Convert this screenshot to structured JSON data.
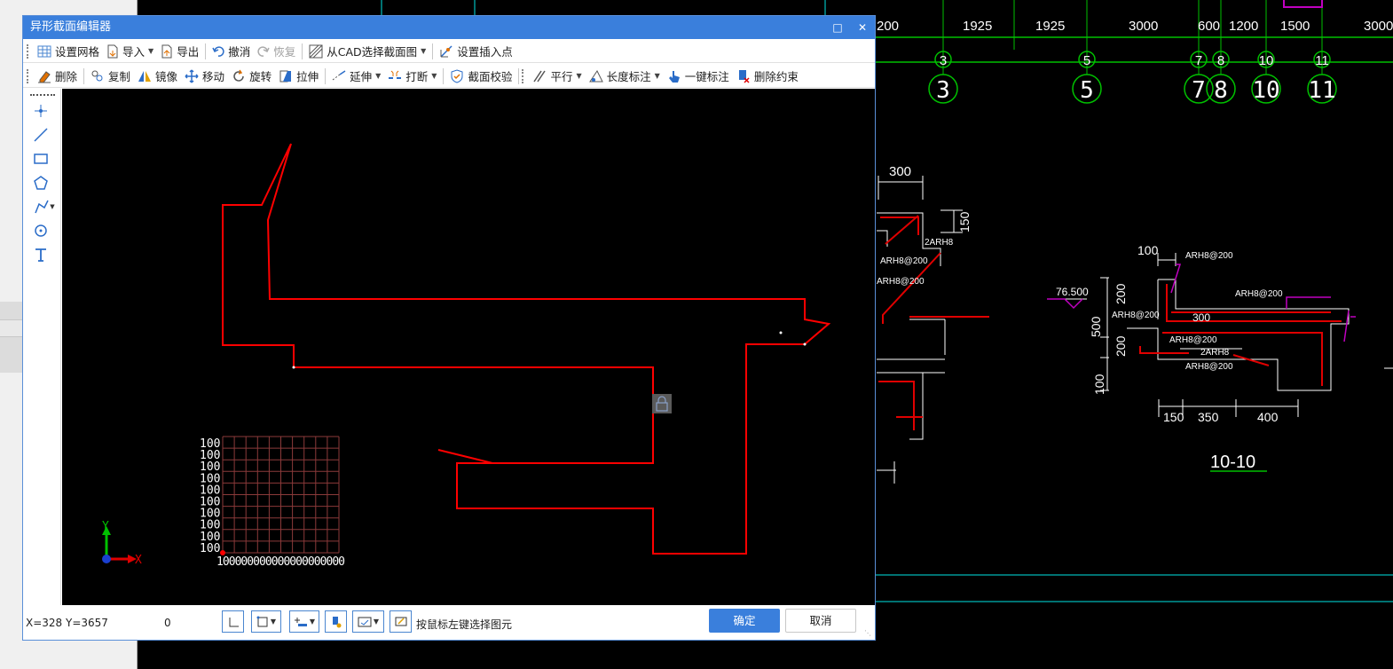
{
  "dialog": {
    "title": "异形截面编辑器",
    "maximize_icon": "maximize-icon",
    "close_icon": "close-icon"
  },
  "toolbar1": {
    "items": [
      {
        "label": "设置网格",
        "icon": "grid-icon"
      },
      {
        "label": "导入",
        "icon": "import-icon",
        "dropdown": true
      },
      {
        "label": "导出",
        "icon": "export-icon"
      },
      {
        "label": "撤消",
        "icon": "undo-icon"
      },
      {
        "label": "恢复",
        "icon": "redo-icon",
        "disabled": true
      },
      {
        "label": "从CAD选择截面图",
        "icon": "cad-select-icon",
        "dropdown": true
      },
      {
        "label": "设置插入点",
        "icon": "insert-point-icon"
      }
    ]
  },
  "toolbar2": {
    "items": [
      {
        "label": "删除",
        "icon": "eraser-icon"
      },
      {
        "label": "复制",
        "icon": "copy-icon"
      },
      {
        "label": "镜像",
        "icon": "mirror-icon"
      },
      {
        "label": "移动",
        "icon": "move-icon"
      },
      {
        "label": "旋转",
        "icon": "rotate-icon"
      },
      {
        "label": "拉伸",
        "icon": "stretch-icon"
      },
      {
        "label": "延伸",
        "icon": "extend-icon",
        "dropdown": true
      },
      {
        "label": "打断",
        "icon": "break-icon",
        "dropdown": true
      },
      {
        "label": "截面校验",
        "icon": "shield-check-icon"
      },
      {
        "label": "平行",
        "icon": "parallel-icon",
        "dropdown": true
      },
      {
        "label": "长度标注",
        "icon": "dimension-icon",
        "dropdown": true
      },
      {
        "label": "一键标注",
        "icon": "one-click-dim-icon"
      },
      {
        "label": "删除约束",
        "icon": "delete-constraint-icon"
      }
    ]
  },
  "left_tools": [
    "point-icon",
    "line-icon",
    "rectangle-icon",
    "polygon-icon",
    "polyline-icon",
    "circle-icon",
    "text-icon"
  ],
  "canvas": {
    "grid_labels_y": [
      "100",
      "100",
      "100",
      "100",
      "100",
      "100",
      "100",
      "100",
      "100",
      "100"
    ],
    "grid_label_x": "100000000000000000000",
    "axis_x": "X",
    "axis_y": "Y"
  },
  "status": {
    "coords": "X=328 Y=3657",
    "value": "0",
    "hint": "按鼠标左键选择图元",
    "ok": "确定",
    "cancel": "取消"
  },
  "cad": {
    "top_dims": [
      "200",
      "1925",
      "1925",
      "3000",
      "600",
      "1200",
      "1500",
      "3000"
    ],
    "axis_labels": [
      "3",
      "5",
      "7",
      "8",
      "10",
      "11"
    ],
    "dims_left": [
      "300",
      "150"
    ],
    "rebar_left": [
      "2ARH8",
      "ARH8@200",
      "ARH8@200"
    ],
    "section_dims": [
      "100",
      "200",
      "500",
      "200",
      "100",
      "150",
      "350",
      "400",
      "300",
      "76.500"
    ],
    "rebar_right": [
      "ARH8@200",
      "ARH8@200",
      "ARH8@200",
      "ARH8@200",
      "2ARH8",
      "ARH8@200"
    ],
    "section_title": "10-10"
  },
  "colors": {
    "accent": "#3a7fdc",
    "shape": "#ff0000",
    "grid": "#8b3a3a",
    "axis_green": "#00c000",
    "cad_white": "#ffffff",
    "cad_cyan": "#00e5e5",
    "cad_magenta": "#c000c0"
  }
}
